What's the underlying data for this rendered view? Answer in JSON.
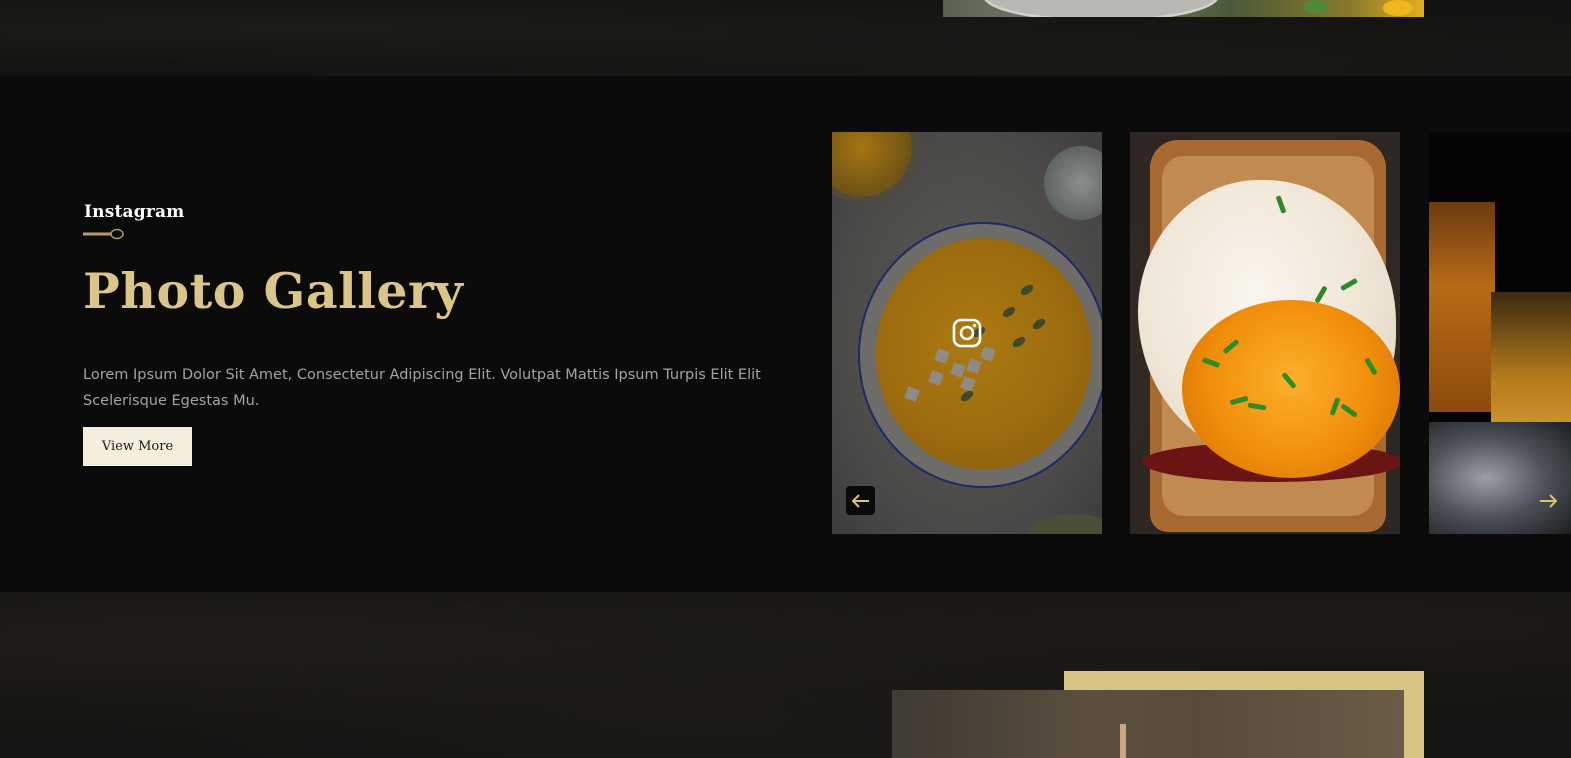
{
  "section": {
    "subtitle": "Instagram",
    "heading": "Photo Gallery",
    "description": "Lorem Ipsum Dolor Sit Amet, Consectetur Adipiscing Elit. Volutpat Mattis Ipsum Turpis Elit Elit Scelerisque Egestas Mu.",
    "button_label": "View More"
  },
  "gallery": {
    "items": [
      {
        "image": "soup-bowl-photo",
        "hover_icon": "instagram-icon"
      },
      {
        "image": "fried-egg-toast-photo"
      },
      {
        "image": "whiskey-glasses-photo"
      }
    ],
    "prev_icon": "arrow-left-icon",
    "next_icon": "arrow-right-icon"
  },
  "colors": {
    "accent_gold": "#dbc588",
    "section_bg": "#0b0b0b",
    "button_bg": "#f5eedd",
    "text_muted": "#a3a3a3"
  }
}
